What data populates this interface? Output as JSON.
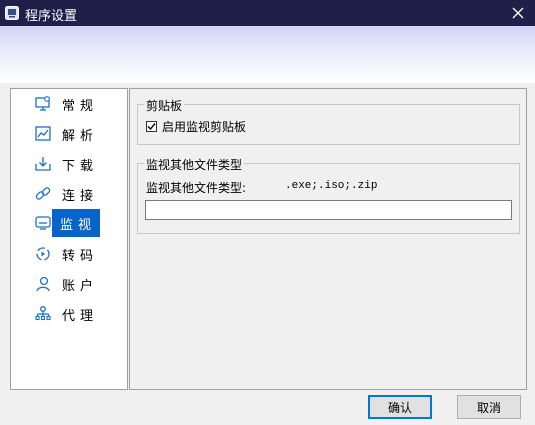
{
  "window": {
    "title": "程序设置",
    "close_icon": "close-icon"
  },
  "sidebar": {
    "items": [
      {
        "label": "常规",
        "icon": "monitor-gear-icon",
        "active": false
      },
      {
        "label": "解析",
        "icon": "chart-icon",
        "active": false
      },
      {
        "label": "下载",
        "icon": "download-tray-icon",
        "active": false
      },
      {
        "label": "连接",
        "icon": "link-icon",
        "active": false
      },
      {
        "label": "监视",
        "icon": "screen-monitor-icon",
        "active": true
      },
      {
        "label": "转码",
        "icon": "convert-icon",
        "active": false
      },
      {
        "label": "账户",
        "icon": "user-icon",
        "active": false
      },
      {
        "label": "代理",
        "icon": "proxy-network-icon",
        "active": false
      }
    ]
  },
  "clipboard_group": {
    "title": "剪贴板",
    "checkbox_label": "启用监视剪贴板",
    "checked": true
  },
  "filetype_group": {
    "title": "监视其他文件类型",
    "field_label": "监视其他文件类型:",
    "current_types": ".exe;.iso;.zip",
    "input_value": ""
  },
  "buttons": {
    "ok": "确认",
    "cancel": "取消"
  },
  "colors": {
    "titlebar": "#1f1f4a",
    "accent": "#0a64c8",
    "icon_blue": "#1a6fc9"
  }
}
